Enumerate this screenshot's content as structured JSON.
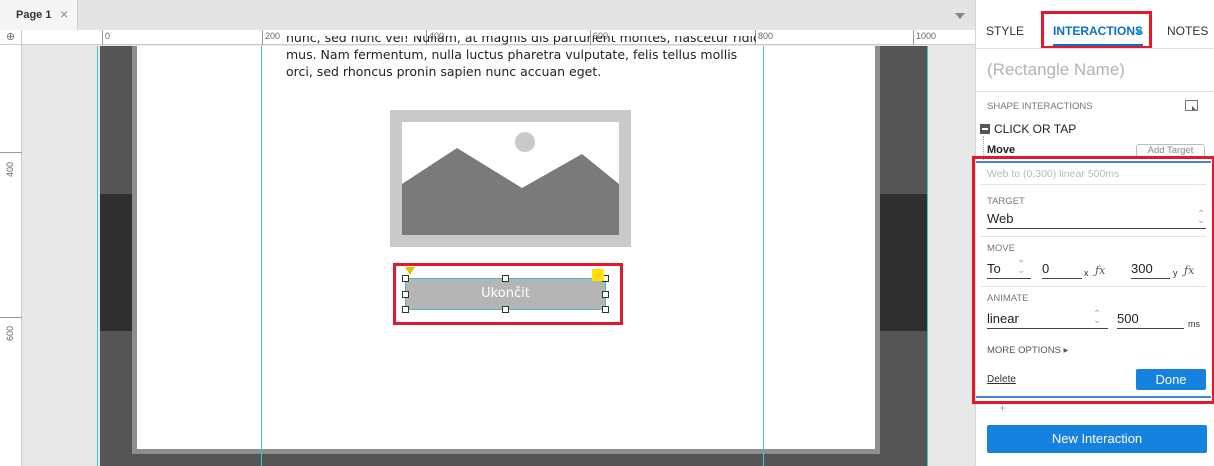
{
  "canvas": {
    "page_tab_label": "Page 1",
    "page_tab_close": "×",
    "ruler_corner": "⊕",
    "ruler_top_labels": [
      "0",
      "200",
      "400",
      "600",
      "800",
      "1000"
    ],
    "ruler_left_labels": [
      "400",
      "600"
    ],
    "lorem_cut_line": "nunc, sed nunc vel! Nullam, at magnis dis parturient montes, nascetur ridiculus",
    "lorem_line_1": "mus. Nam fermentum, nulla luctus pharetra vulputate, felis tellus mollis",
    "lorem_line_2": "orci, sed rhoncus pronin sapien nunc accuan eget.",
    "button_label": "Ukončit",
    "bolt_glyph": "⚡"
  },
  "panel": {
    "tabs": {
      "style": "STYLE",
      "interactions": "INTERACTIONS",
      "notes": "NOTES"
    },
    "shape_name": "(Rectangle Name)",
    "shape_interactions_label": "SHAPE INTERACTIONS",
    "event_label": "CLICK OR TAP",
    "action_label": "Move",
    "add_target_label": "Add Target",
    "summary": "Web to (0,300) linear 500ms",
    "target": {
      "label": "TARGET",
      "value": "Web"
    },
    "move": {
      "label": "MOVE",
      "mode": "To",
      "x_value": "0",
      "x_axis": "x",
      "y_value": "300",
      "y_axis": "y",
      "fx_glyph": "ƒx"
    },
    "animate": {
      "label": "ANIMATE",
      "easing": "linear",
      "duration": "500",
      "unit": "ms"
    },
    "more_options": "MORE OPTIONS ▸",
    "delete_label": "Delete",
    "done_label": "Done",
    "plus_glyph": "+",
    "new_interaction_label": "New Interaction"
  },
  "colors": {
    "accent": "#1682e0",
    "highlight_red": "#e3192b",
    "guide_cyan": "#3ec7c7",
    "placeholder_gray": "#c9c9c9"
  }
}
